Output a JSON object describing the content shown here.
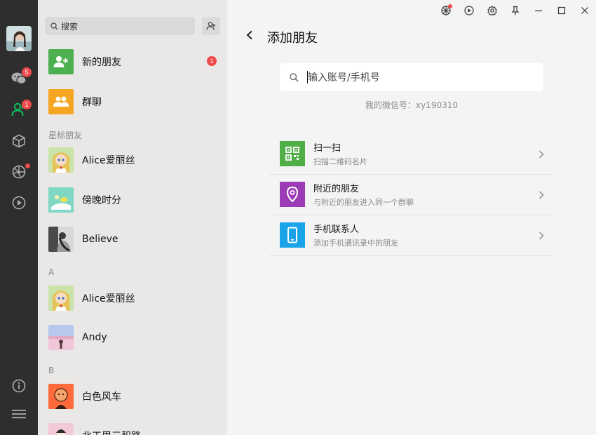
{
  "rail": {
    "chat_badge": "5",
    "contacts_badge": "1"
  },
  "list": {
    "search_placeholder": "搜索",
    "new_friends": {
      "name": "新的朋友",
      "badge": "1"
    },
    "group_chat": {
      "name": "群聊"
    },
    "sections": {
      "starred": "星标朋友",
      "a": "A",
      "b": "B"
    },
    "starred": [
      {
        "name": "Alice爱丽丝"
      },
      {
        "name": "傍晚时分"
      },
      {
        "name": "Believe"
      }
    ],
    "a_items": [
      {
        "name": "Alice爱丽丝"
      },
      {
        "name": "Andy"
      }
    ],
    "b_items": [
      {
        "name": "白色风车"
      },
      {
        "name": "北工里三和路"
      }
    ]
  },
  "main": {
    "title": "添加朋友",
    "input_placeholder": "输入账号/手机号",
    "wechat_id_label": "我的微信号：xy190310",
    "options": [
      {
        "title": "扫一扫",
        "subtitle": "扫描二维码名片",
        "color": "#4fae45"
      },
      {
        "title": "附近的朋友",
        "subtitle": "与附近的朋友进入同一个群聊",
        "color": "#9b3bb5"
      },
      {
        "title": "手机联系人",
        "subtitle": "添加手机通讯录中的朋友",
        "color": "#1aa3e8"
      }
    ]
  },
  "colors": {
    "accent": "#07c160",
    "badge": "#f04a4a",
    "rail": "#2e2e2e"
  }
}
